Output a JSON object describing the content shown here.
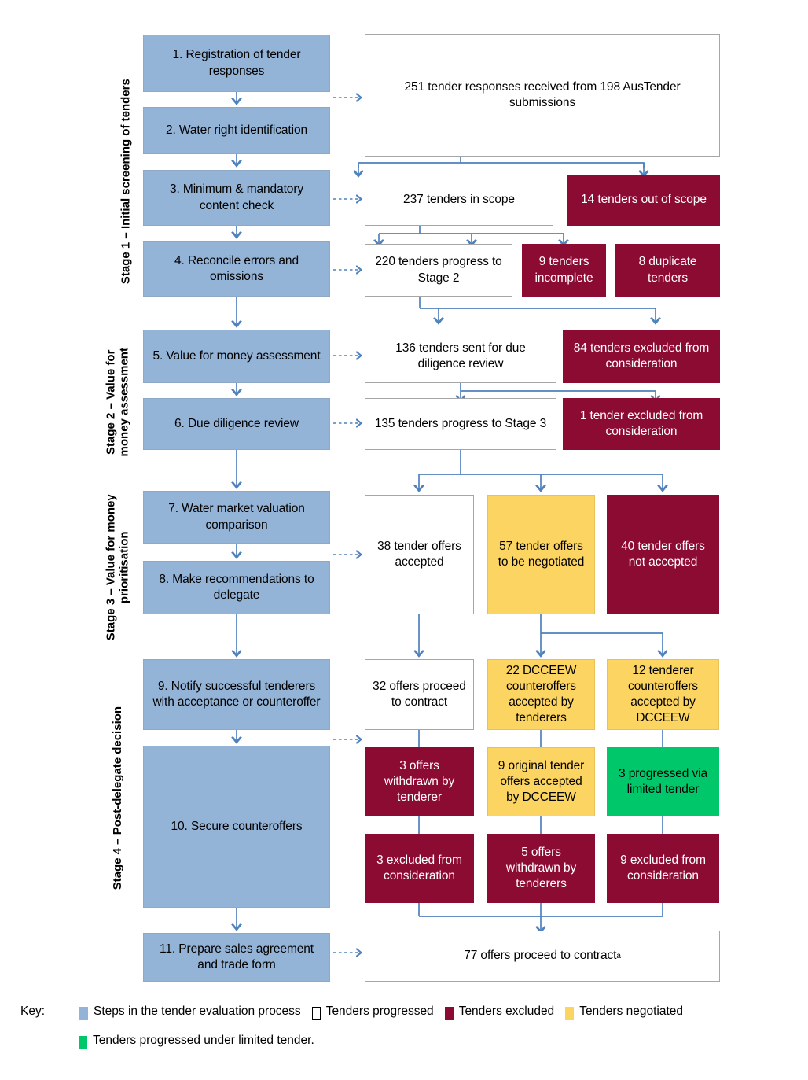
{
  "diagram": {
    "title": "Tender evaluation process flowchart",
    "colors": {
      "step": "#93b3d7",
      "progressed": "#ffffff",
      "excluded": "#8c0b33",
      "negotiated": "#fcd462",
      "limited_tender": "#00c769",
      "connector": "#4f81bd"
    },
    "stages": [
      {
        "id": "stage1",
        "label": "Stage 1 – Initial screening of tenders"
      },
      {
        "id": "stage2",
        "label": "Stage 2 – Value for money assessment"
      },
      {
        "id": "stage3",
        "label": "Stage 3 – Value for money prioritisation"
      },
      {
        "id": "stage4",
        "label": "Stage 4 – Post-delegate decision"
      }
    ],
    "steps": [
      {
        "id": "s1",
        "label": "1. Registration of tender responses"
      },
      {
        "id": "s2",
        "label": "2. Water right identification"
      },
      {
        "id": "s3",
        "label": "3. Minimum & mandatory content check"
      },
      {
        "id": "s4",
        "label": "4. Reconcile errors and omissions"
      },
      {
        "id": "s5",
        "label": "5. Value for money assessment"
      },
      {
        "id": "s6",
        "label": "6. Due diligence review"
      },
      {
        "id": "s7",
        "label": "7. Water market valuation comparison"
      },
      {
        "id": "s8",
        "label": "8. Make recommendations to delegate"
      },
      {
        "id": "s9",
        "label": "9. Notify successful tenderers with acceptance or counteroffer"
      },
      {
        "id": "s10",
        "label": "10. Secure counteroffers"
      },
      {
        "id": "s11",
        "label": "11. Prepare sales agreement and trade form"
      }
    ],
    "outcomes": [
      {
        "id": "o1",
        "type": "progressed",
        "label": "251 tender responses received from 198 AusTender submissions"
      },
      {
        "id": "o2",
        "type": "progressed",
        "label": "237 tenders in scope"
      },
      {
        "id": "o3",
        "type": "excluded",
        "label": "14 tenders out of scope"
      },
      {
        "id": "o4",
        "type": "progressed",
        "label": "220 tenders progress to Stage 2"
      },
      {
        "id": "o5",
        "type": "excluded",
        "label": "9 tenders incomplete"
      },
      {
        "id": "o6",
        "type": "excluded",
        "label": "8 duplicate tenders"
      },
      {
        "id": "o7",
        "type": "progressed",
        "label": "136 tenders sent for due diligence review"
      },
      {
        "id": "o8",
        "type": "excluded",
        "label": "84 tenders excluded from consideration"
      },
      {
        "id": "o9",
        "type": "progressed",
        "label": "135 tenders progress to Stage 3"
      },
      {
        "id": "o10",
        "type": "excluded",
        "label": "1 tender excluded from consideration"
      },
      {
        "id": "o11",
        "type": "progressed",
        "label": "38 tender offers accepted"
      },
      {
        "id": "o12",
        "type": "negotiated",
        "label": "57 tender offers to be negotiated"
      },
      {
        "id": "o13",
        "type": "excluded",
        "label": "40 tender offers not accepted"
      },
      {
        "id": "o14",
        "type": "progressed",
        "label": "32 offers proceed to contract"
      },
      {
        "id": "o15",
        "type": "negotiated",
        "label": "22 DCCEEW counteroffers accepted by tenderers"
      },
      {
        "id": "o16",
        "type": "negotiated",
        "label": "12 tenderer counteroffers accepted by DCCEEW"
      },
      {
        "id": "o17",
        "type": "excluded",
        "label": "3 offers withdrawn by tenderer"
      },
      {
        "id": "o18",
        "type": "negotiated",
        "label": "9 original tender offers accepted by DCCEEW"
      },
      {
        "id": "o19",
        "type": "limited",
        "label": "3 progressed via limited tender"
      },
      {
        "id": "o20",
        "type": "excluded",
        "label": "3 excluded from consideration"
      },
      {
        "id": "o21",
        "type": "excluded",
        "label": "5 offers withdrawn by tenderers"
      },
      {
        "id": "o22",
        "type": "excluded",
        "label": "9 excluded from consideration"
      },
      {
        "id": "o23",
        "type": "progressed",
        "label": "77 offers proceed to contract",
        "superscript": "a"
      }
    ],
    "key": {
      "title": "Key:",
      "items": [
        {
          "swatch": "step",
          "label": "Steps in the tender evaluation process"
        },
        {
          "swatch": "progressed",
          "label": "Tenders progressed"
        },
        {
          "swatch": "excluded",
          "label": "Tenders excluded"
        },
        {
          "swatch": "negotiated",
          "label": "Tenders negotiated"
        },
        {
          "swatch": "limited",
          "label": "Tenders progressed under limited tender."
        }
      ]
    }
  }
}
